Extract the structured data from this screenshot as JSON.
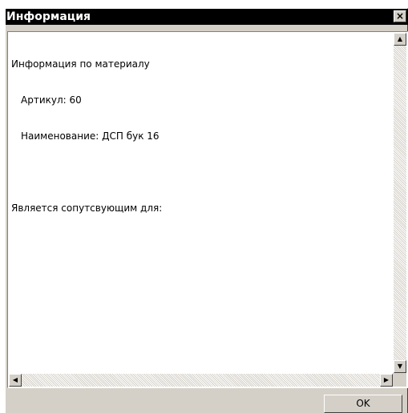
{
  "window": {
    "title": "Информация",
    "close_glyph": "×"
  },
  "content": {
    "lines": [
      "Информация по материалу",
      "Артикул: 60",
      "Наименование: ДСП бук 16",
      "",
      "Является сопутсвующим для:"
    ]
  },
  "scrollbars": {
    "up_glyph": "▲",
    "down_glyph": "▼",
    "left_glyph": "◀",
    "right_glyph": "▶"
  },
  "footer": {
    "ok_label": "OK"
  }
}
